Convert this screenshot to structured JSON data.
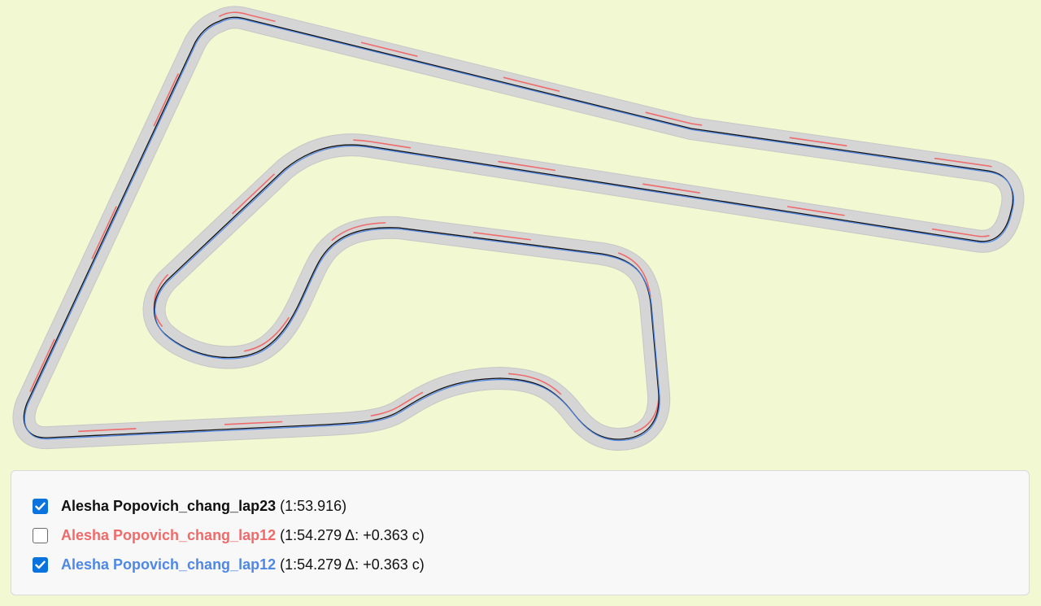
{
  "colors": {
    "background": "#f2f8d2",
    "track_surface": "#d5d5d5",
    "track_edge": "#c6c6c6",
    "lap_black": "#111111",
    "lap_red": "#f06a6a",
    "lap_blue": "#4f87e6",
    "checkbox_blue": "#0b73de"
  },
  "legend": {
    "laps": [
      {
        "checked": true,
        "name": "Alesha Popovich_chang_lap23",
        "time": "(1:53.916)",
        "color": "#111111"
      },
      {
        "checked": false,
        "name": "Alesha Popovich_chang_lap12",
        "time": "(1:54.279 Δ: +0.363 с)",
        "color": "#f06a6a"
      },
      {
        "checked": true,
        "name": "Alesha Popovich_chang_lap12",
        "time": "(1:54.279 Δ: +0.363 с)",
        "color": "#4f87e6"
      }
    ]
  }
}
